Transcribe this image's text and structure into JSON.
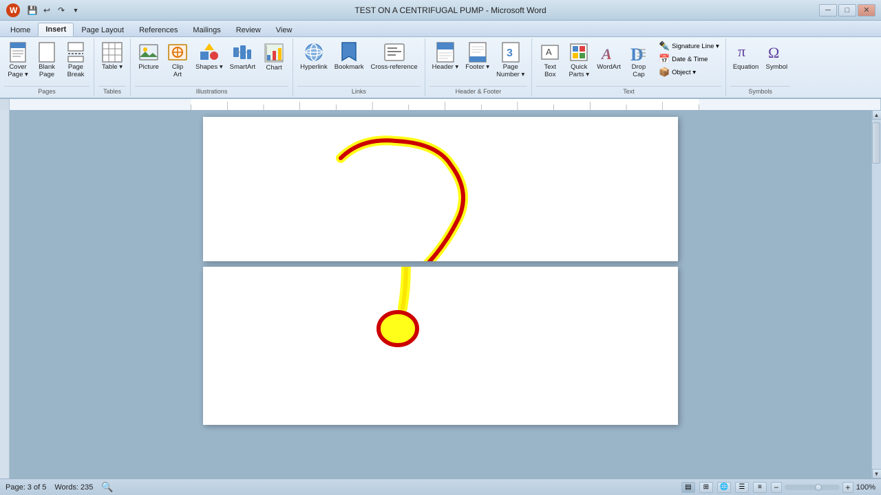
{
  "titlebar": {
    "title": "TEST ON A CENTRIFUGAL PUMP - Microsoft Word",
    "minimize": "─",
    "maximize": "□",
    "close": "✕"
  },
  "quickaccess": {
    "save": "💾",
    "undo": "↩",
    "undo_arrow": "↶",
    "redo": "↷",
    "more": "▼"
  },
  "tabs": [
    {
      "label": "Home",
      "active": false
    },
    {
      "label": "Insert",
      "active": true
    },
    {
      "label": "Page Layout",
      "active": false
    },
    {
      "label": "References",
      "active": false
    },
    {
      "label": "Mailings",
      "active": false
    },
    {
      "label": "Review",
      "active": false
    },
    {
      "label": "View",
      "active": false
    }
  ],
  "ribbon": {
    "groups": [
      {
        "name": "Pages",
        "buttons": [
          {
            "label": "Cover\nPage",
            "icon": "page_cover",
            "type": "large-dropdown"
          },
          {
            "label": "Blank\nPage",
            "icon": "page_blank",
            "type": "large"
          },
          {
            "label": "Page\nBreak",
            "icon": "page_break",
            "type": "large"
          }
        ]
      },
      {
        "name": "Tables",
        "buttons": [
          {
            "label": "Table",
            "icon": "table",
            "type": "large-dropdown"
          }
        ]
      },
      {
        "name": "Illustrations",
        "buttons": [
          {
            "label": "Picture",
            "icon": "picture",
            "type": "large"
          },
          {
            "label": "Clip\nArt",
            "icon": "clipart",
            "type": "large"
          },
          {
            "label": "Shapes",
            "icon": "shapes",
            "type": "large-dropdown"
          },
          {
            "label": "SmartArt",
            "icon": "smartart",
            "type": "large"
          },
          {
            "label": "Chart",
            "icon": "chart",
            "type": "large"
          }
        ]
      },
      {
        "name": "Links",
        "buttons": [
          {
            "label": "Hyperlink",
            "icon": "hyperlink",
            "type": "large"
          },
          {
            "label": "Bookmark",
            "icon": "bookmark",
            "type": "large"
          },
          {
            "label": "Cross-reference",
            "icon": "crossref",
            "type": "large"
          }
        ]
      },
      {
        "name": "Header & Footer",
        "buttons": [
          {
            "label": "Header",
            "icon": "header",
            "type": "large-dropdown"
          },
          {
            "label": "Footer",
            "icon": "footer",
            "type": "large-dropdown"
          },
          {
            "label": "Page\nNumber",
            "icon": "pagenumber",
            "type": "large-dropdown"
          }
        ]
      },
      {
        "name": "Text",
        "buttons": [
          {
            "label": "Text\nBox",
            "icon": "textbox",
            "type": "large"
          },
          {
            "label": "Quick\nParts",
            "icon": "quickparts",
            "type": "large-dropdown"
          },
          {
            "label": "WordArt",
            "icon": "wordart",
            "type": "large"
          },
          {
            "label": "Drop\nCap",
            "icon": "dropcap",
            "type": "large"
          },
          {
            "label": "Signature Line",
            "icon": "sigline",
            "type": "small"
          },
          {
            "label": "Date & Time",
            "icon": "datetime",
            "type": "small"
          },
          {
            "label": "Object",
            "icon": "object",
            "type": "small-dropdown"
          }
        ]
      },
      {
        "name": "Symbols",
        "buttons": [
          {
            "label": "Equation",
            "icon": "equation",
            "type": "large"
          },
          {
            "label": "Symbol",
            "icon": "symbol",
            "type": "large"
          }
        ]
      }
    ]
  },
  "statusbar": {
    "page_info": "Page: 3 of 5",
    "words": "Words: 235",
    "zoom_level": "100%"
  }
}
